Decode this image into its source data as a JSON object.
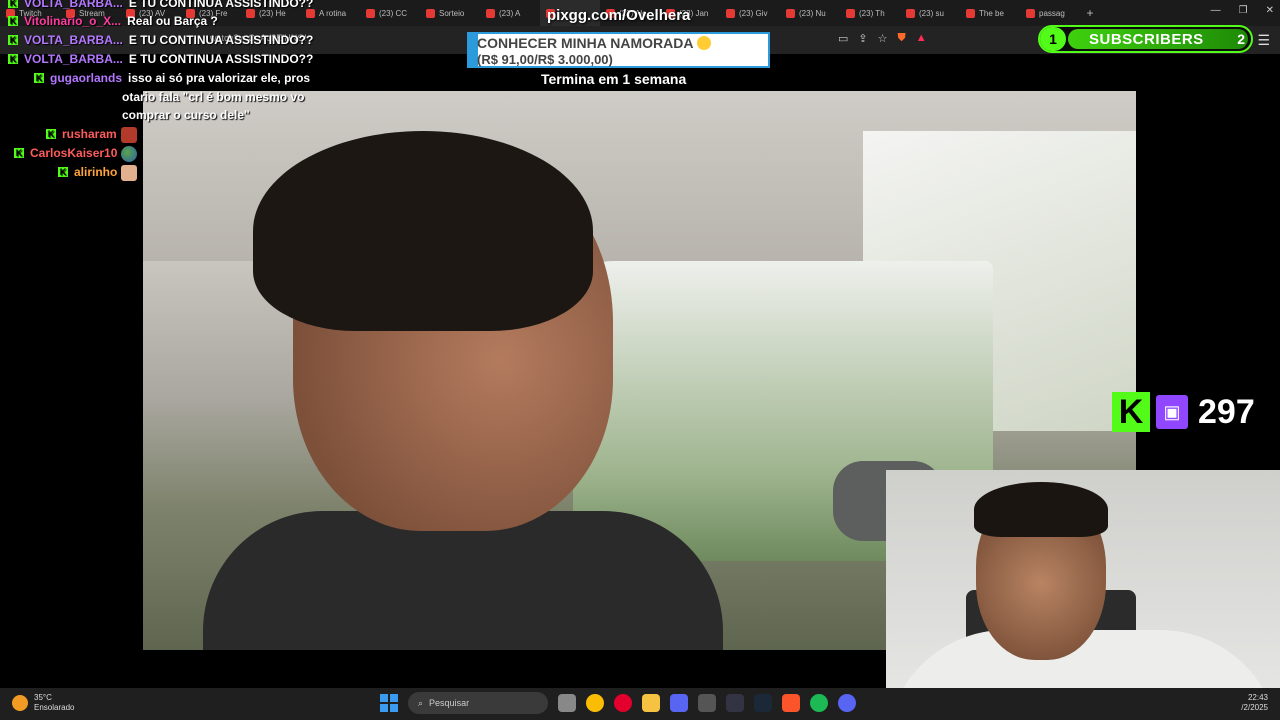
{
  "browser": {
    "tabs": [
      {
        "label": "Twitch",
        "icon": "twitch-icon"
      },
      {
        "label": "Stream",
        "icon": "kick-icon"
      },
      {
        "label": "(23) AV",
        "icon": "youtube-icon"
      },
      {
        "label": "(23) Fre",
        "icon": "youtube-icon"
      },
      {
        "label": "(23) He",
        "icon": "youtube-icon"
      },
      {
        "label": "A rotina",
        "icon": "youtube-icon"
      },
      {
        "label": "(23) CC",
        "icon": "youtube-icon"
      },
      {
        "label": "Sorteio",
        "icon": "sorteio-icon"
      },
      {
        "label": "(23) A",
        "icon": "youtube-icon"
      },
      {
        "label": "",
        "icon": "youtube-icon"
      },
      {
        "label": "(23) Ale",
        "icon": "youtube-icon"
      },
      {
        "label": "(23) Jan",
        "icon": "youtube-icon"
      },
      {
        "label": "(23) Giv",
        "icon": "youtube-icon"
      },
      {
        "label": "(23) Nu",
        "icon": "youtube-icon"
      },
      {
        "label": "(23) Th",
        "icon": "youtube-icon"
      },
      {
        "label": "(23) su",
        "icon": "youtube-icon"
      },
      {
        "label": "The be",
        "icon": "generic-icon"
      },
      {
        "label": "passag",
        "icon": "google-icon"
      }
    ],
    "new_tab": "+",
    "url": "watch?v=O_Ad8EjHNOI"
  },
  "chat": [
    {
      "user": "VOLTA_BARBA...",
      "user_color": "#b478ff",
      "msg": "E TU CONTINUA ASSISTINDO??"
    },
    {
      "user": "Vitolinario_o_X...",
      "user_color": "#ff3ba0",
      "msg": "Real ou Barça ?"
    },
    {
      "user": "VOLTA_BARBA...",
      "user_color": "#b478ff",
      "msg": "E TU CONTINUA ASSISTINDO??"
    },
    {
      "user": "VOLTA_BARBA...",
      "user_color": "#b478ff",
      "msg": "E TU CONTINUA ASSISTINDO??"
    },
    {
      "user": "gugaorlands",
      "user_color": "#b478ff",
      "msg": "isso ai só pra valorizar ele, pros"
    },
    {
      "user": "",
      "user_color": "#ffffff",
      "msg": "otario fala \"crl é bom mesmo vo"
    },
    {
      "user": "",
      "user_color": "#ffffff",
      "msg": "comprar o curso dele\""
    },
    {
      "user": "rusharam",
      "user_color": "#ff5b5b",
      "msg": ""
    },
    {
      "user": "CarlosKaiser10",
      "user_color": "#ff5b5b",
      "msg": ""
    },
    {
      "user": "alirinho",
      "user_color": "#ffa43a",
      "msg": ""
    }
  ],
  "overlay": {
    "pix_url": "pixgg.com/Ovelhera",
    "goal_title": "CONHECER MINHA NAMORADA",
    "goal_amount": "(R$ 91,00/R$ 3.000,00)",
    "goal_progress": 0.03,
    "ends_text": "Termina em 1 semana"
  },
  "subs_widget": {
    "count": "1",
    "label": "SUBSCRIBERS",
    "goal": "2"
  },
  "follower_counter": {
    "value": "297"
  },
  "taskbar": {
    "temp": "35°C",
    "weather": "Ensolarado",
    "search_placeholder": "Pesquisar",
    "time": "22:43",
    "date": "/2/2025"
  },
  "colors": {
    "kick_green": "#53fc18",
    "twitch_purple": "#9146ff",
    "goal_blue": "#2b9bdc"
  }
}
